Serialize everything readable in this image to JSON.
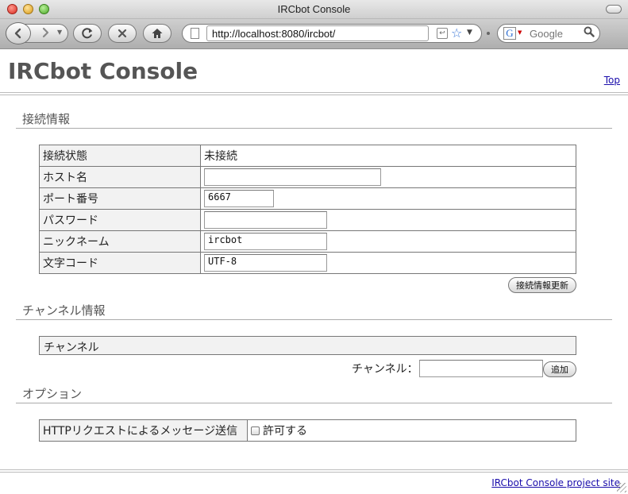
{
  "window": {
    "title": "IRCbot Console"
  },
  "browser": {
    "url": "http://localhost:8080/ircbot/",
    "search_placeholder": "Google",
    "search_engine_glyph": "G"
  },
  "page": {
    "title": "IRCbot Console",
    "top_link": "Top",
    "footer_link": "IRCbot Console project site"
  },
  "connection": {
    "heading": "接続情報",
    "rows": [
      {
        "label": "接続状態",
        "value": "未接続"
      },
      {
        "label": "ホスト名",
        "value": ""
      },
      {
        "label": "ポート番号",
        "value": "6667"
      },
      {
        "label": "パスワード",
        "value": ""
      },
      {
        "label": "ニックネーム",
        "value": "ircbot"
      },
      {
        "label": "文字コード",
        "value": "UTF-8"
      }
    ],
    "update_button": "接続情報更新"
  },
  "channel": {
    "heading": "チャンネル情報",
    "table_header": "チャンネル",
    "input_label": "チャンネル：",
    "input_value": "",
    "add_button": "追加"
  },
  "options": {
    "heading": "オプション",
    "http_label": "HTTPリクエストによるメッセージ送信",
    "allow_label": "許可する",
    "allow_checked": false
  },
  "icons": {
    "back": "back-arrow-icon",
    "forward": "forward-arrow-icon",
    "reload": "reload-icon",
    "stop": "stop-icon",
    "home": "home-icon",
    "bookmark": "star-icon",
    "search": "magnifier-icon"
  }
}
